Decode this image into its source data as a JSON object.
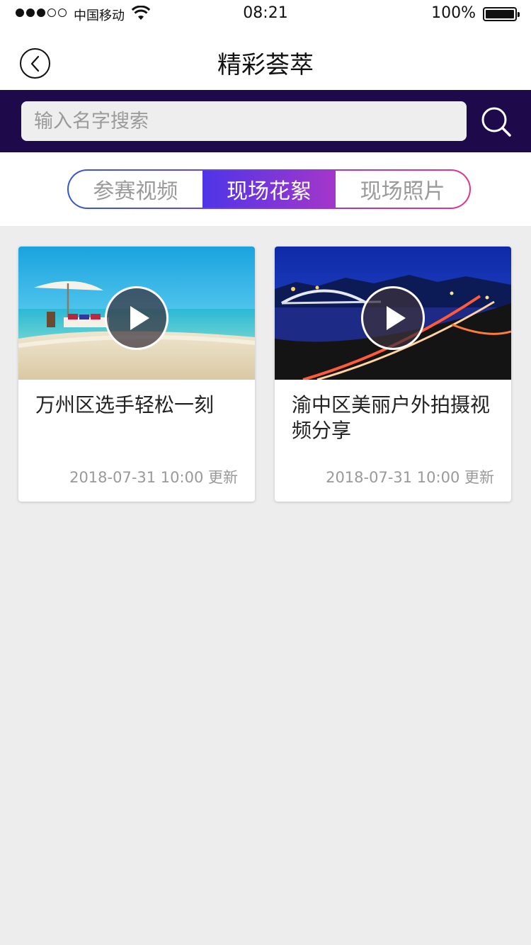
{
  "status_bar": {
    "carrier": "中国移动",
    "time": "08:21",
    "battery": "100%"
  },
  "header": {
    "title": "精彩荟萃"
  },
  "search": {
    "placeholder": "输入名字搜索"
  },
  "tabs": [
    {
      "label": "参赛视频",
      "active": false
    },
    {
      "label": "现场花絮",
      "active": true
    },
    {
      "label": "现场照片",
      "active": false
    }
  ],
  "videos": [
    {
      "title": "万州区选手轻松一刻",
      "time": "2018-07-31   10:00 更新",
      "thumbnail": "beach-umbrella-image"
    },
    {
      "title": "渝中区美丽户外拍摄视频分享",
      "time": "2018-07-31   10:00 更新",
      "thumbnail": "night-bridge-image"
    }
  ],
  "colors": {
    "search_bar_bg": "#1e0a4a",
    "tab_active_start": "#4e35e8",
    "tab_active_end": "#a536c9",
    "page_bg": "#ededed"
  }
}
